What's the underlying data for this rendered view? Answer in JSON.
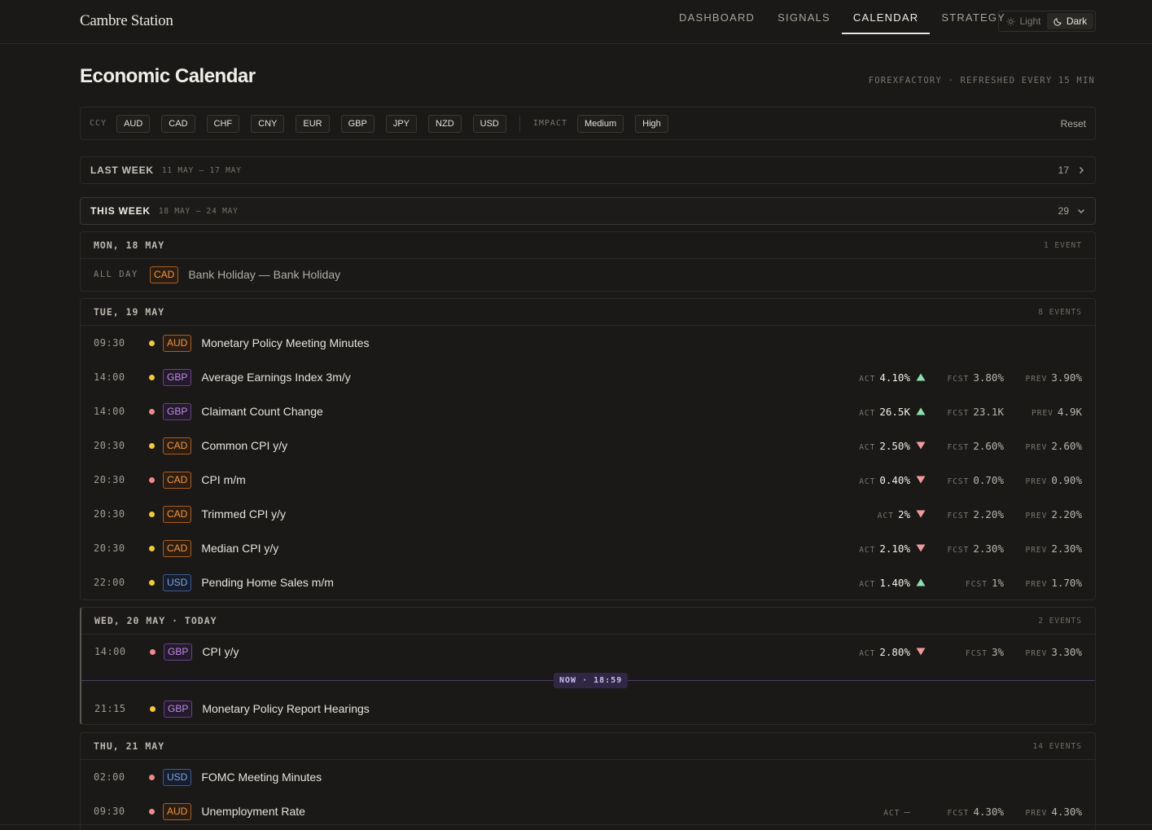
{
  "app": {
    "brand": "Cambre Station",
    "nav": [
      "DASHBOARD",
      "SIGNALS",
      "CALENDAR",
      "STRATEGY"
    ],
    "theme_light": "Light",
    "theme_dark": "Dark"
  },
  "page": {
    "title": "Economic Calendar",
    "source": "FOREXFACTORY · REFRESHED EVERY 15 MIN"
  },
  "filters": {
    "ccy_label": "CCY",
    "currencies": [
      "AUD",
      "CAD",
      "CHF",
      "CNY",
      "EUR",
      "GBP",
      "JPY",
      "NZD",
      "USD"
    ],
    "impact_label": "IMPACT",
    "impacts": [
      "Medium",
      "High"
    ],
    "reset": "Reset"
  },
  "weeks": {
    "last": {
      "name": "LAST WEEK",
      "range": "11 MAY – 17 MAY",
      "count": "17"
    },
    "this": {
      "name": "THIS WEEK",
      "range": "18 MAY – 24 MAY",
      "count": "29"
    }
  },
  "labels": {
    "act": "ACT",
    "fcst": "FCST",
    "prev": "PREV"
  },
  "now": "NOW · 18:59",
  "days": {
    "mon": {
      "name": "MON, 18 MAY",
      "count": "1 EVENT",
      "events": [
        {
          "time": "ALL DAY",
          "ccy": "CAD",
          "title": "Bank Holiday — Bank Holiday"
        }
      ]
    },
    "tue": {
      "name": "TUE, 19 MAY",
      "count": "8 EVENTS",
      "events": [
        {
          "time": "09:30",
          "impact": "medium",
          "ccy": "AUD",
          "title": "Monetary Policy Meeting Minutes"
        },
        {
          "time": "14:00",
          "impact": "medium",
          "ccy": "GBP",
          "title": "Average Earnings Index 3m/y",
          "act": "4.10%",
          "dir": "up",
          "fcst": "3.80%",
          "prev": "3.90%"
        },
        {
          "time": "14:00",
          "impact": "high",
          "ccy": "GBP",
          "title": "Claimant Count Change",
          "act": "26.5K",
          "dir": "up",
          "fcst": "23.1K",
          "prev": "4.9K"
        },
        {
          "time": "20:30",
          "impact": "medium",
          "ccy": "CAD",
          "title": "Common CPI y/y",
          "act": "2.50%",
          "dir": "down",
          "fcst": "2.60%",
          "prev": "2.60%"
        },
        {
          "time": "20:30",
          "impact": "high",
          "ccy": "CAD",
          "title": "CPI m/m",
          "act": "0.40%",
          "dir": "down",
          "fcst": "0.70%",
          "prev": "0.90%"
        },
        {
          "time": "20:30",
          "impact": "medium",
          "ccy": "CAD",
          "title": "Trimmed CPI y/y",
          "act": "2%",
          "dir": "down",
          "fcst": "2.20%",
          "prev": "2.20%"
        },
        {
          "time": "20:30",
          "impact": "medium",
          "ccy": "CAD",
          "title": "Median CPI y/y",
          "act": "2.10%",
          "dir": "down",
          "fcst": "2.30%",
          "prev": "2.30%"
        },
        {
          "time": "22:00",
          "impact": "medium",
          "ccy": "USD",
          "title": "Pending Home Sales m/m",
          "act": "1.40%",
          "dir": "up",
          "fcst": "1%",
          "prev": "1.70%"
        }
      ]
    },
    "wed": {
      "name": "WED, 20 MAY · TODAY",
      "count": "2 EVENTS",
      "events": [
        {
          "time": "14:00",
          "impact": "high",
          "ccy": "GBP",
          "title": "CPI y/y",
          "act": "2.80%",
          "dir": "down",
          "fcst": "3%",
          "prev": "3.30%"
        },
        {
          "time": "21:15",
          "impact": "medium",
          "ccy": "GBP",
          "title": "Monetary Policy Report Hearings"
        }
      ]
    },
    "thu": {
      "name": "THU, 21 MAY",
      "count": "14 EVENTS",
      "events": [
        {
          "time": "02:00",
          "impact": "high",
          "ccy": "USD",
          "title": "FOMC Meeting Minutes"
        },
        {
          "time": "09:30",
          "impact": "high",
          "ccy": "AUD",
          "title": "Unemployment Rate",
          "act": "—",
          "fcst": "4.30%",
          "prev": "4.30%"
        }
      ]
    }
  }
}
